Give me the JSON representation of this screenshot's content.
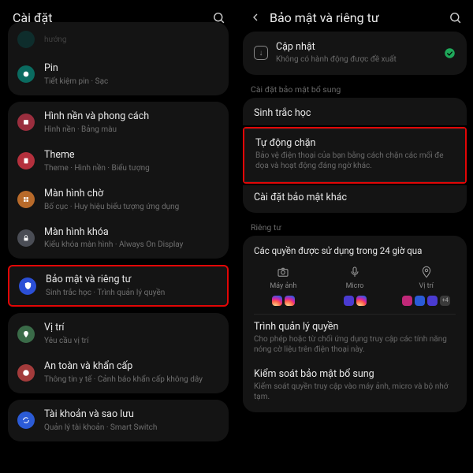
{
  "left": {
    "title": "Cài đặt",
    "items": [
      {
        "title": "...",
        "sub": "hướng"
      },
      {
        "title": "Pin",
        "sub": "Tiết kiệm pin · Sạc"
      },
      {
        "title": "Hình nền và phong cách",
        "sub": "Hình nền · Bảng màu"
      },
      {
        "title": "Theme",
        "sub": "Theme · Hình nền · Biểu tượng"
      },
      {
        "title": "Màn hình chờ",
        "sub": "Bố cục · Huy hiệu biểu tượng ứng dụng"
      },
      {
        "title": "Màn hình khóa",
        "sub": "Kiểu khóa màn hình · Always On Display"
      },
      {
        "title": "Bảo mật và riêng tư",
        "sub": "Sinh trắc học · Trình quản lý quyền"
      },
      {
        "title": "Vị trí",
        "sub": "Yêu cầu vị trí"
      },
      {
        "title": "An toàn và khẩn cấp",
        "sub": "Thông tin y tế · Cảnh báo khẩn cấp không dây"
      },
      {
        "title": "Tài khoản và sao lưu",
        "sub": "Quản lý tài khoản · Smart Switch"
      }
    ]
  },
  "right": {
    "title": "Bảo mật và riêng tư",
    "update": {
      "title": "Cập nhật",
      "sub": "Không có hành động được đề xuất"
    },
    "extra_label": "Cài đặt bảo mật bổ sung",
    "biometrics": "Sinh trắc học",
    "autoblock": {
      "title": "Tự động chặn",
      "sub": "Bảo vệ điện thoại của bạn bằng cách chặn các mối đe dọa và hoạt động đáng ngờ khác."
    },
    "other_security": "Cài đặt bảo mật khác",
    "privacy_label": "Riêng tư",
    "perm24": "Các quyền được sử dụng trong 24 giờ qua",
    "perms": {
      "camera": "Máy ảnh",
      "micro": "Micro",
      "location": "Vị trí",
      "more": "+4"
    },
    "perm_manager": {
      "title": "Trình quản lý quyền",
      "sub": "Cho phép hoặc từ chối ứng dụng truy cập các tính năng nóng cờ liệu trên điện thoại này."
    },
    "privacy_control": {
      "title": "Kiểm soát bảo mật bổ sung",
      "sub": "Kiểm soát quyền truy cập vào máy ảnh, micro và bộ nhớ tạm."
    }
  }
}
